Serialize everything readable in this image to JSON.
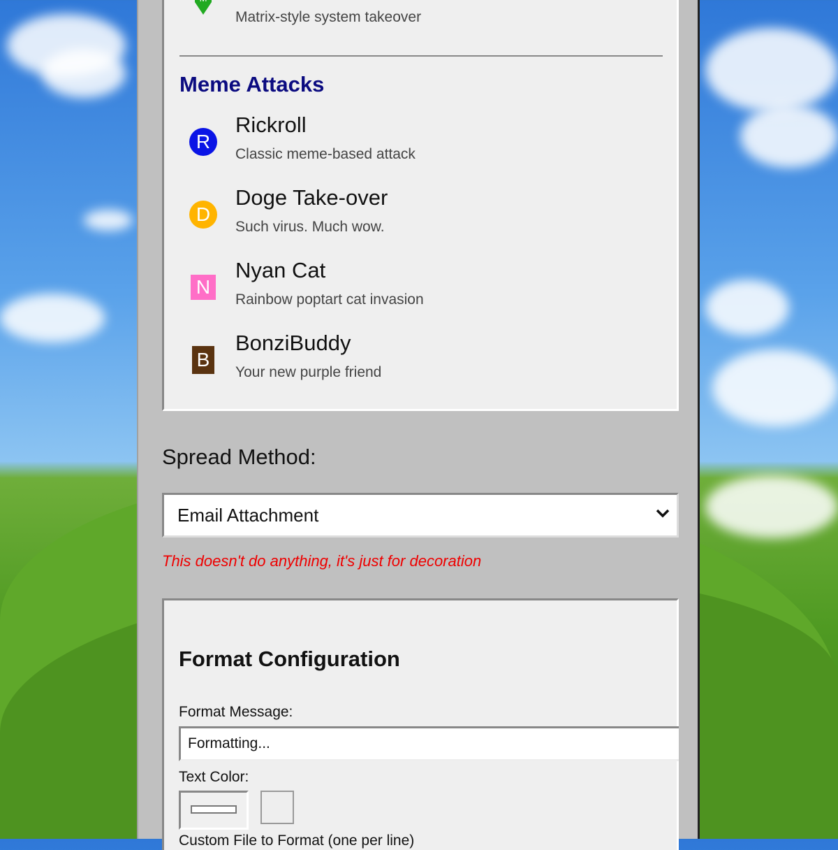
{
  "malware_list": {
    "top_item": {
      "description": "Matrix-style system takeover",
      "icon": "matrix-shield-icon",
      "color": "#22aa22"
    },
    "section_title": "Meme Attacks",
    "items": [
      {
        "icon_letter": "R",
        "icon": "circle-r-icon",
        "color": "#0a14e6",
        "shape": "circle",
        "name": "Rickroll",
        "description": "Classic meme-based attack"
      },
      {
        "icon_letter": "D",
        "icon": "circle-d-icon",
        "color": "#ffb400",
        "shape": "circle",
        "name": "Doge Take-over",
        "description": "Such virus. Much wow."
      },
      {
        "icon_letter": "N",
        "icon": "square-n-icon",
        "color": "#ff6ec7",
        "shape": "square",
        "name": "Nyan Cat",
        "description": "Rainbow poptart cat invasion"
      },
      {
        "icon_letter": "B",
        "icon": "square-b-icon",
        "color": "#5a3310",
        "shape": "square",
        "name": "BonziBuddy",
        "description": "Your new purple friend"
      }
    ]
  },
  "spread": {
    "label": "Spread Method:",
    "selected": "Email Attachment",
    "note": "This doesn't do anything, it's just for decoration"
  },
  "format_config": {
    "title": "Format Configuration",
    "message_label": "Format Message:",
    "message_value": "Formatting...",
    "text_color_label": "Text Color:",
    "next_label_partial": "Custom File to Format (one per line)"
  }
}
